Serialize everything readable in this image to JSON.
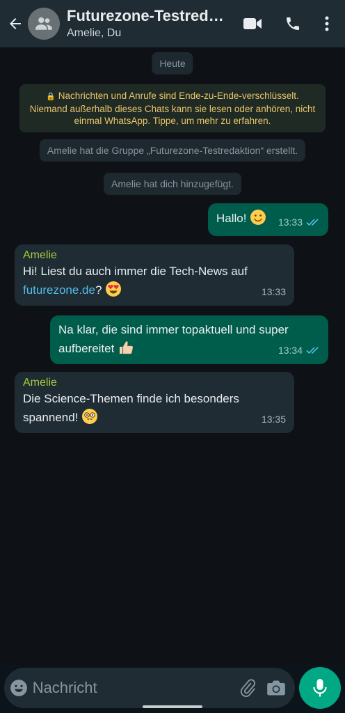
{
  "header": {
    "title": "Futurezone-Testredaktion",
    "subtitle": "Amelie, Du"
  },
  "chat": {
    "date_label": "Heute",
    "encryption_notice": "Nachrichten und Anrufe sind Ende-zu-Ende-verschlüsselt. Niemand außerhalb dieses Chats kann sie lesen oder anhören, nicht einmal WhatsApp. Tippe, um mehr zu erfahren.",
    "system_messages": [
      "Amelie hat die Gruppe „Futurezone-Testredaktion“ erstellt.",
      "Amelie hat dich hinzugefügt."
    ],
    "messages": [
      {
        "direction": "out",
        "text": "Hallo!",
        "emoji": "slightly-smiling-face",
        "time": "13:33",
        "status": "read"
      },
      {
        "direction": "in",
        "sender": "Amelie",
        "text_before": "Hi! Liest du auch immer die Tech-News auf",
        "link": "futurezone.de",
        "text_after": "?",
        "emoji": "heart-eyes-face",
        "time": "13:33"
      },
      {
        "direction": "out",
        "text": "Na klar, die sind immer topaktuell und super aufbereitet",
        "emoji": "thumbs-up",
        "time": "13:34",
        "status": "read"
      },
      {
        "direction": "in",
        "sender": "Amelie",
        "text": "Die Science-Themen finde ich besonders spannend!",
        "emoji": "nerd-face",
        "time": "13:35"
      }
    ]
  },
  "composer": {
    "placeholder": "Nachricht"
  },
  "colors": {
    "header_bg": "#1f2c34",
    "chat_bg": "#0e1217",
    "outgoing_bubble": "#005c4b",
    "incoming_bubble": "#1f2c34",
    "sender_name": "#a5c93f",
    "link": "#53bdeb",
    "read_ticks": "#53bdeb",
    "encryption_text": "#e9c46a",
    "mic_button": "#00a884"
  },
  "icons": [
    "back-arrow-icon",
    "group-avatar-icon",
    "video-call-icon",
    "voice-call-icon",
    "more-vert-icon",
    "emoji-icon",
    "attach-icon",
    "camera-icon",
    "mic-icon",
    "lock-icon",
    "double-check-icon"
  ]
}
